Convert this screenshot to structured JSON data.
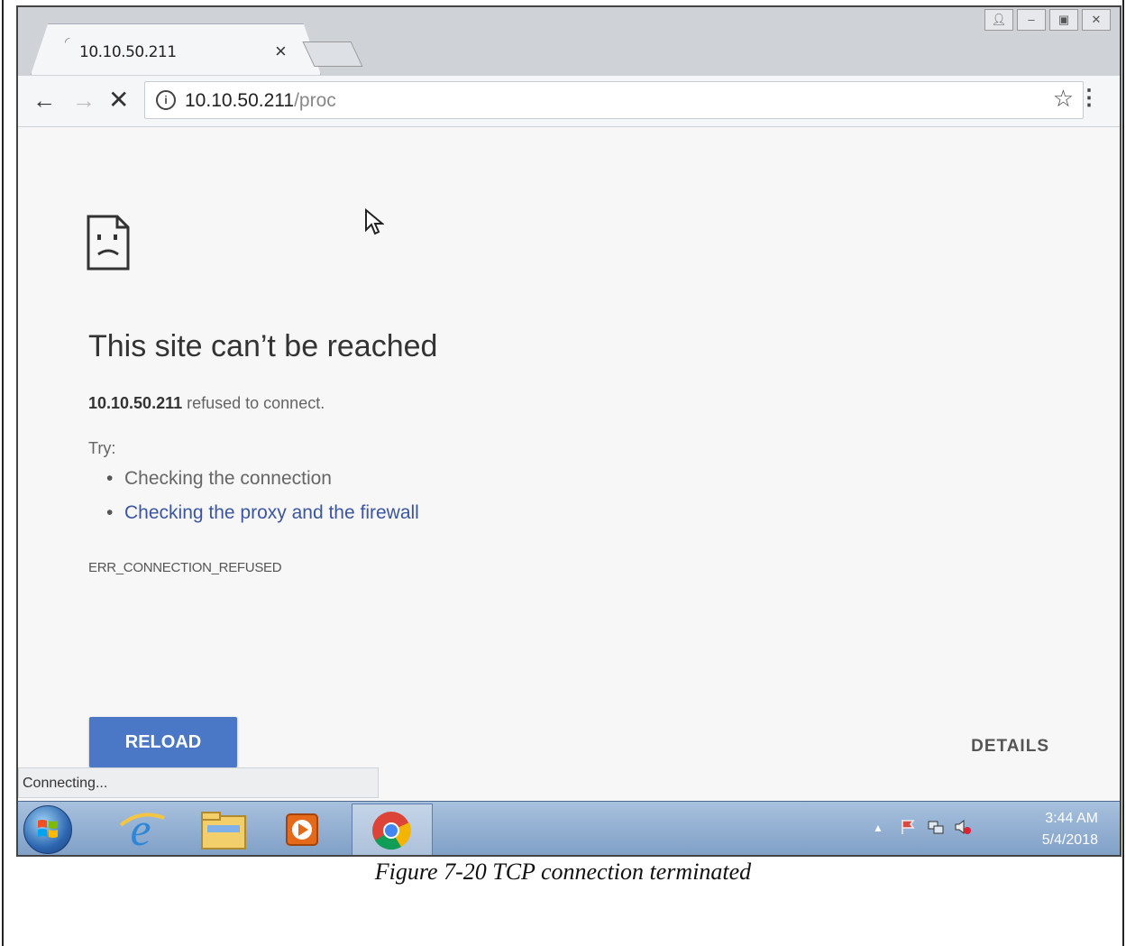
{
  "browser": {
    "tab_title": "10.10.50.211",
    "tab_close": "×",
    "url_host": "10.10.50.211",
    "url_path": "/proc"
  },
  "error_page": {
    "heading": "This site can’t be reached",
    "host": "10.10.50.211",
    "refused_text": " refused to connect.",
    "try_label": "Try:",
    "suggestions": [
      "Checking the connection",
      "Checking the proxy and the firewall"
    ],
    "error_code": "ERR_CONNECTION_REFUSED",
    "reload_label": "RELOAD",
    "details_label": "DETAILS",
    "status_text": "Connecting..."
  },
  "taskbar": {
    "time": "3:44 AM",
    "date": "5/4/2018"
  },
  "caption": "Figure 7-20 TCP connection terminated",
  "colors": {
    "reload_button": "#4a78c7",
    "link": "#3a56a0",
    "taskbar": "#8fadd2"
  }
}
